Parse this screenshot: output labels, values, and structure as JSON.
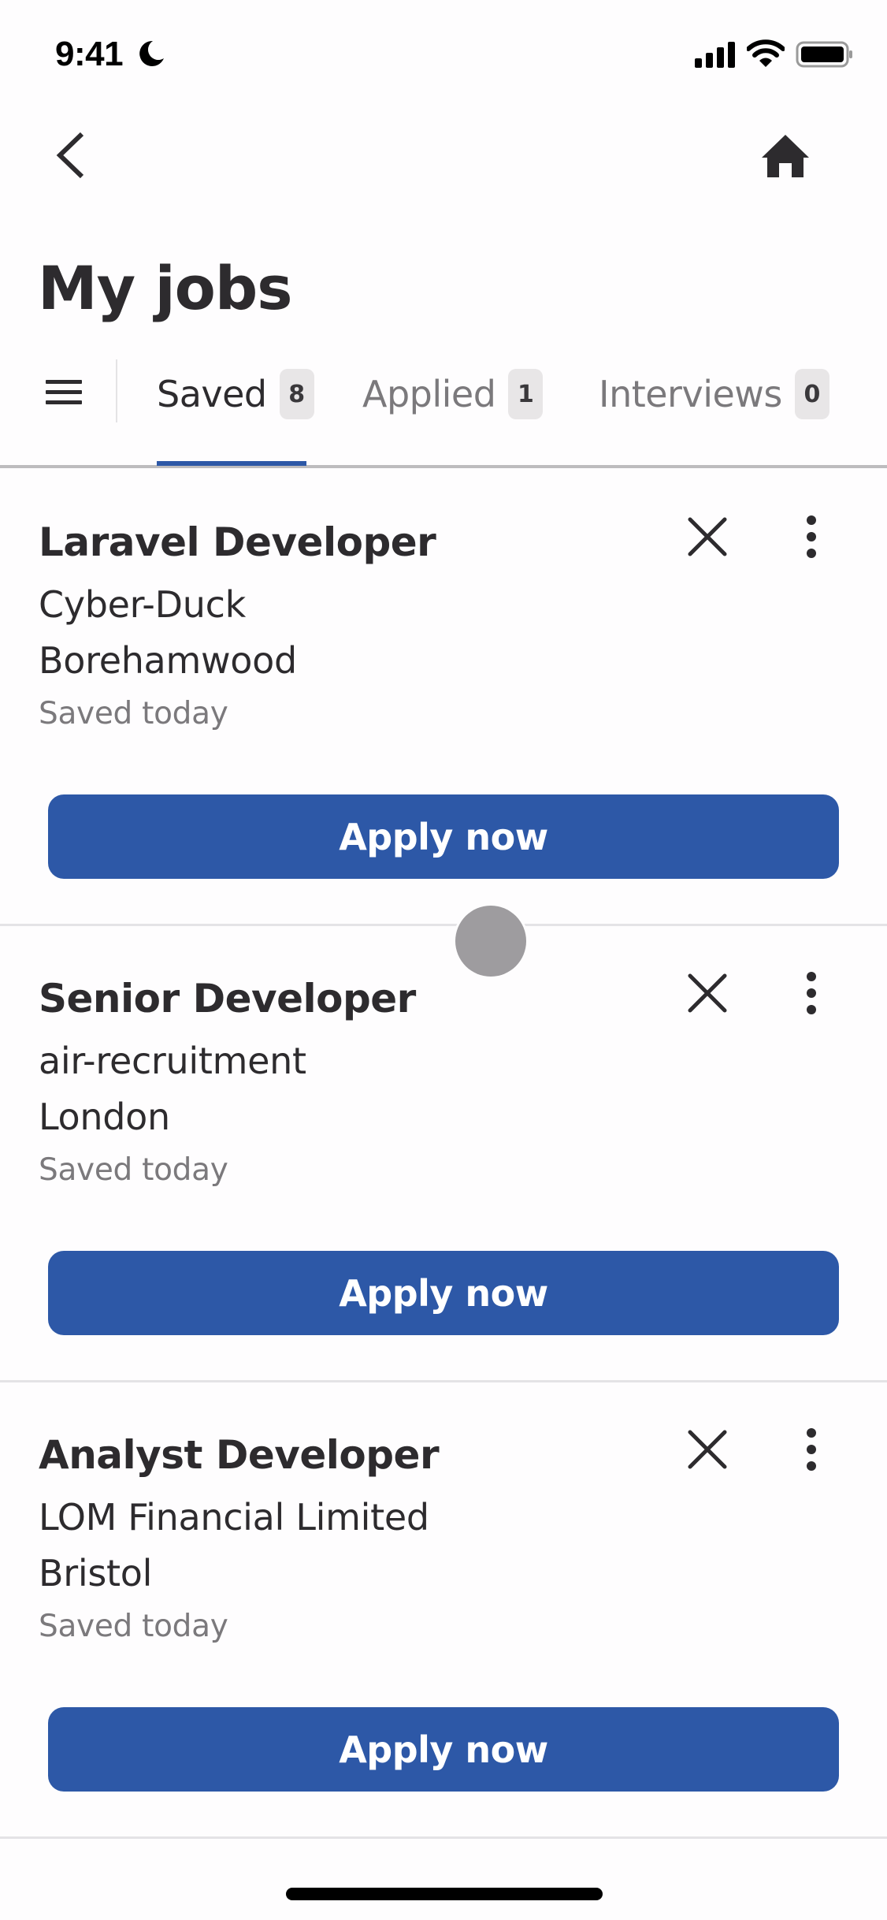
{
  "status_bar": {
    "time": "9:41",
    "focus_icon": "moon-icon",
    "signal_icon": "cellular-signal-icon",
    "wifi_icon": "wifi-icon",
    "battery_icon": "battery-icon"
  },
  "nav": {
    "back_icon": "chevron-left-icon",
    "home_icon": "home-icon"
  },
  "page": {
    "title": "My jobs"
  },
  "tabs": {
    "menu_icon": "hamburger-menu-icon",
    "items": [
      {
        "label": "Saved",
        "count": "8",
        "active": true
      },
      {
        "label": "Applied",
        "count": "1",
        "active": false
      },
      {
        "label": "Interviews",
        "count": "0",
        "active": false
      }
    ]
  },
  "jobs": [
    {
      "title": "Laravel Developer",
      "company": "Cyber-Duck",
      "location": "Borehamwood",
      "saved": "Saved today",
      "apply_label": "Apply now"
    },
    {
      "title": "Senior Developer",
      "company": "air-recruitment",
      "location": "London",
      "saved": "Saved today",
      "apply_label": "Apply now"
    },
    {
      "title": "Analyst Developer",
      "company": "LOM Financial Limited",
      "location": "Bristol",
      "saved": "Saved today",
      "apply_label": "Apply now"
    }
  ],
  "colors": {
    "accent": "#2d58a7",
    "text_primary": "#2d2b2e",
    "text_secondary": "#7b797c",
    "badge_bg": "#e8e6e7",
    "divider": "#e4e3e6"
  }
}
